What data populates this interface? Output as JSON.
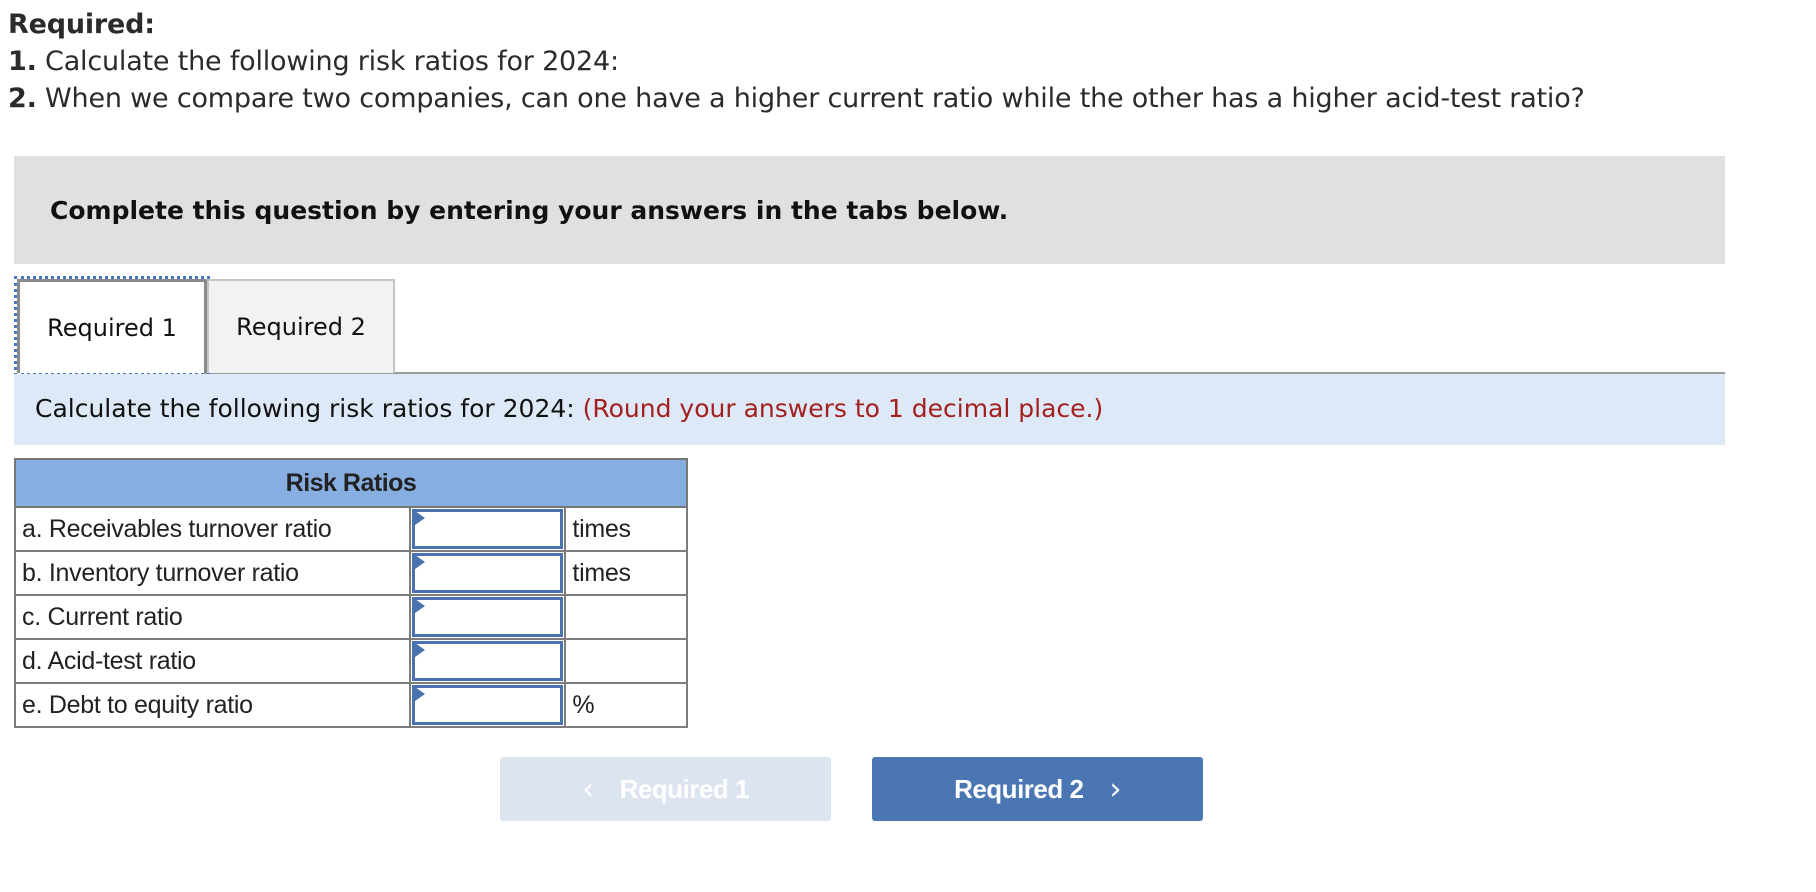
{
  "required": {
    "title": "Required:",
    "items": [
      {
        "num": "1.",
        "text": " Calculate the following risk ratios for 2024:"
      },
      {
        "num": "2.",
        "text": " When we compare two companies, can one have a higher current ratio while the other has a higher acid-test ratio?"
      }
    ]
  },
  "instructions": "Complete this question by entering your answers in the tabs below.",
  "tabs": [
    {
      "label": "Required 1",
      "active": true
    },
    {
      "label": "Required 2",
      "active": false
    }
  ],
  "prompt": {
    "text": "Calculate the following risk ratios for 2024: ",
    "note": "(Round your answers to 1 decimal place.)"
  },
  "table": {
    "header": "Risk Ratios",
    "rows": [
      {
        "label": "a. Receivables turnover ratio",
        "value": "",
        "unit": "times"
      },
      {
        "label": "b. Inventory turnover ratio",
        "value": "",
        "unit": "times"
      },
      {
        "label": "c. Current ratio",
        "value": "",
        "unit": ""
      },
      {
        "label": "d. Acid-test ratio",
        "value": "",
        "unit": ""
      },
      {
        "label": "e. Debt to equity ratio",
        "value": "",
        "unit": "%"
      }
    ]
  },
  "nav": {
    "prev_label": "Required 1",
    "prev_icon": "chevron-left-icon",
    "prev_disabled": true,
    "next_label": "Required 2",
    "next_icon": "chevron-right-icon",
    "prev_chevron": "‹",
    "next_chevron": "›"
  },
  "colors": {
    "accent": "#4a76b4",
    "note": "#a3201e",
    "header_bg": "#87aee0",
    "band_bg": "#dde9f6"
  }
}
